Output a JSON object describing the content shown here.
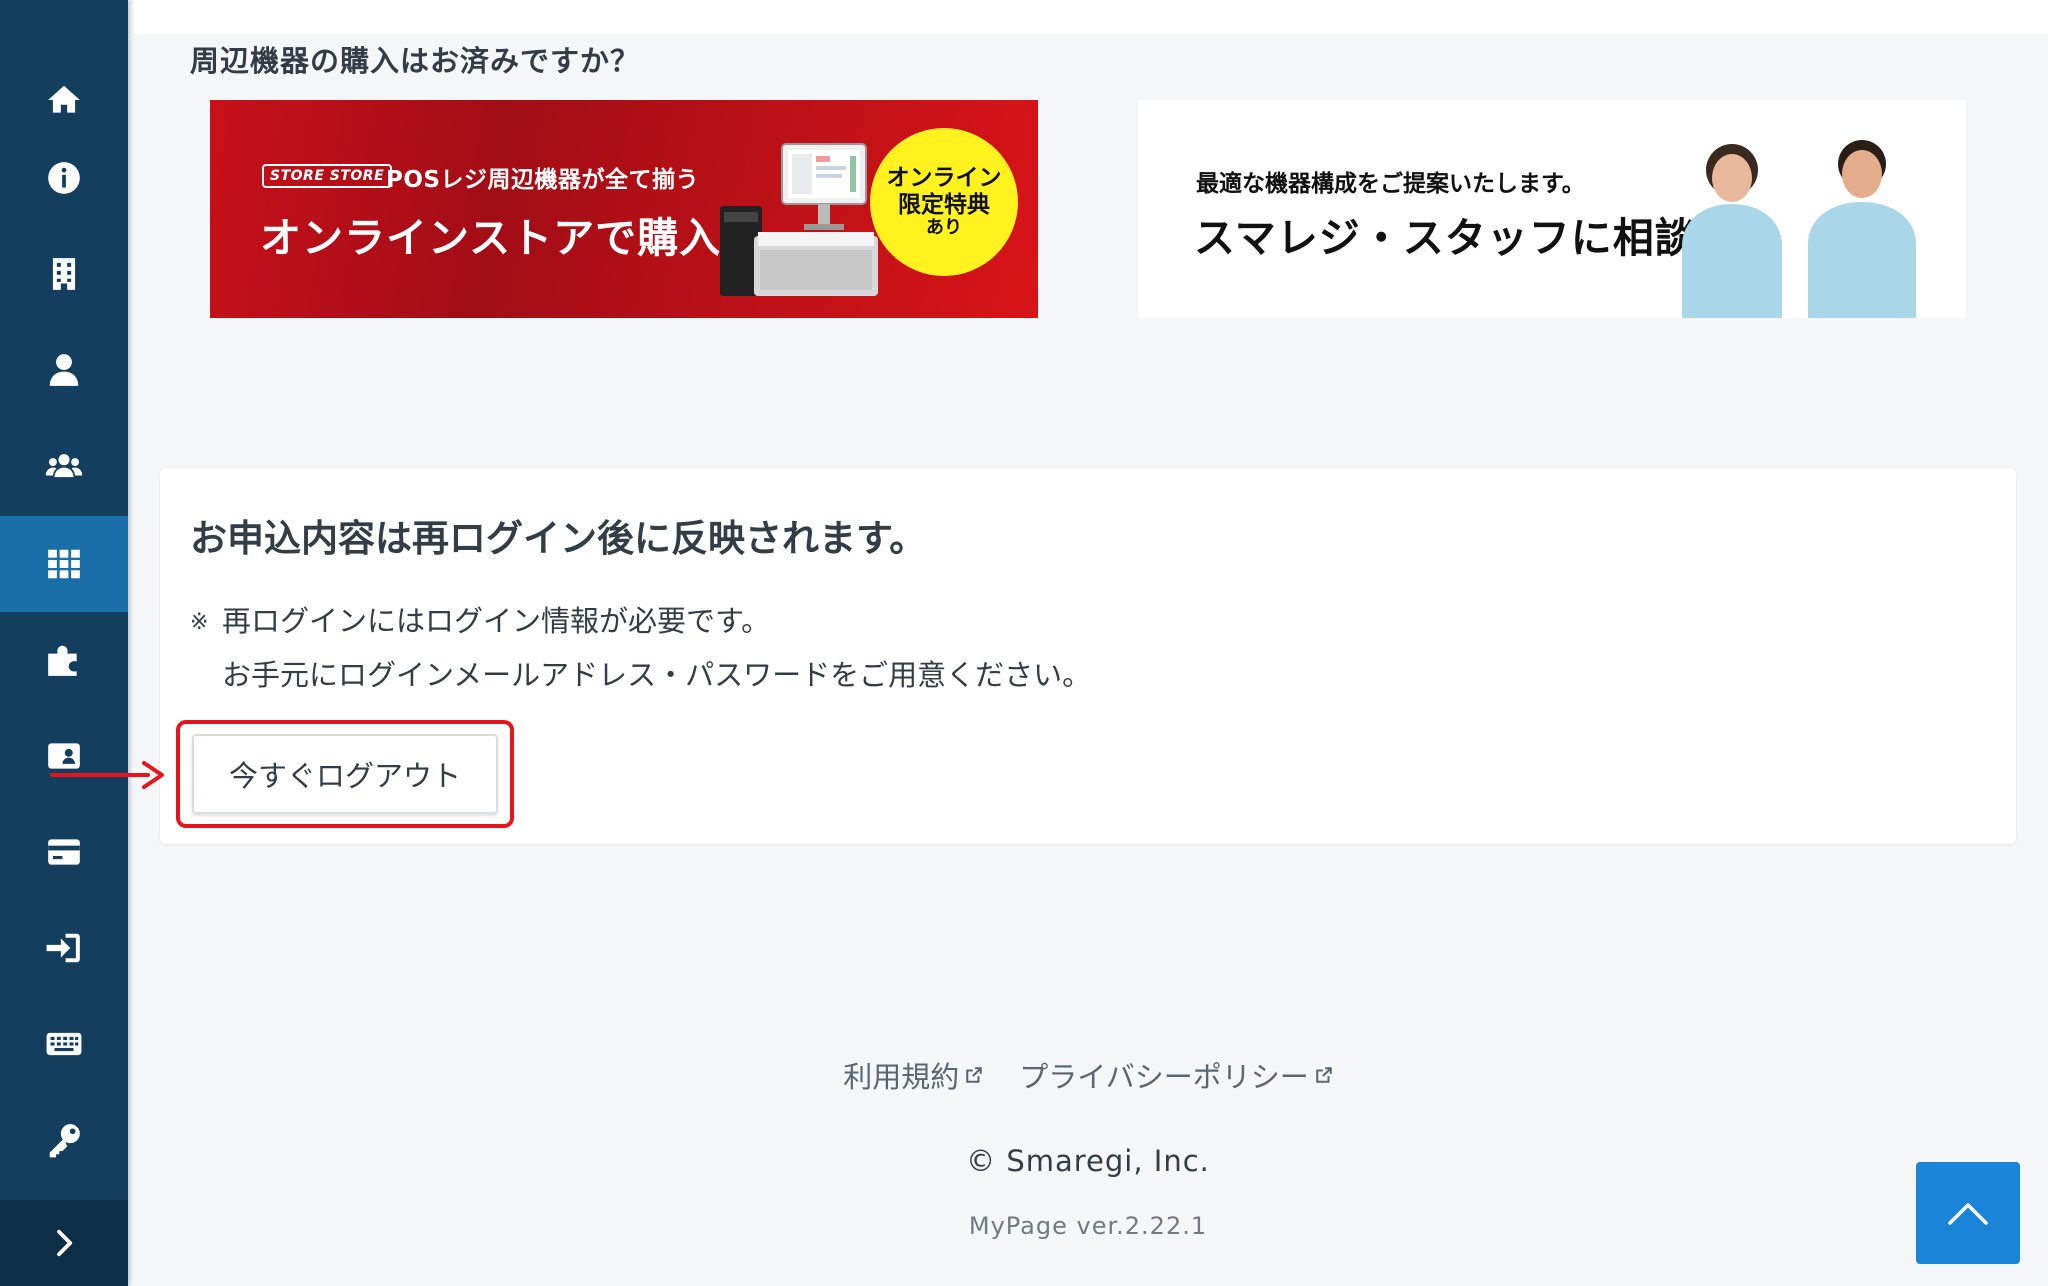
{
  "sidebar": {
    "items": [
      {
        "icon": "home-icon",
        "active": false
      },
      {
        "icon": "info-icon",
        "active": false
      },
      {
        "icon": "building-icon",
        "active": false
      },
      {
        "icon": "user-icon",
        "active": false
      },
      {
        "icon": "users-icon",
        "active": false
      },
      {
        "icon": "apps-grid-icon",
        "active": true
      },
      {
        "icon": "puzzle-icon",
        "active": false
      },
      {
        "icon": "id-card-icon",
        "active": false
      },
      {
        "icon": "credit-card-icon",
        "active": false
      },
      {
        "icon": "sign-in-icon",
        "active": false
      },
      {
        "icon": "keyboard-icon",
        "active": false
      },
      {
        "icon": "key-icon",
        "active": false
      }
    ],
    "toggle_icon": "chevron-right-icon",
    "accent_color": "#1a6fa8",
    "background_color": "#133e5e"
  },
  "peripherals": {
    "heading": "周辺機器の購入はお済みですか？",
    "store_banner": {
      "tag": "STORE STORE",
      "subtitle": "POSレジ周辺機器が全て揃う",
      "title": "オンラインストアで購入",
      "badge_line1": "オンライン",
      "badge_line2": "限定特典",
      "badge_line3": "あり"
    },
    "staff_banner": {
      "subtitle": "最適な機器構成をご提案いたします。",
      "title": "スマレジ・スタッフに相談"
    }
  },
  "notice_card": {
    "title": "お申込内容は再ログイン後に反映されます。",
    "note_mark": "※",
    "note_line1": "再ログインにはログイン情報が必要です。",
    "note_line2": "お手元にログインメールアドレス・パスワードをご用意ください。",
    "logout_button_label": "今すぐログアウト",
    "highlight_color": "#e8141c"
  },
  "footer": {
    "terms_link": "利用規約",
    "privacy_link": "プライバシーポリシー",
    "copyright": "© Smaregi, Inc.",
    "version": "MyPage ver.2.22.1"
  },
  "scroll_top": {
    "icon": "chevron-up-icon",
    "color": "#1a84d9"
  }
}
